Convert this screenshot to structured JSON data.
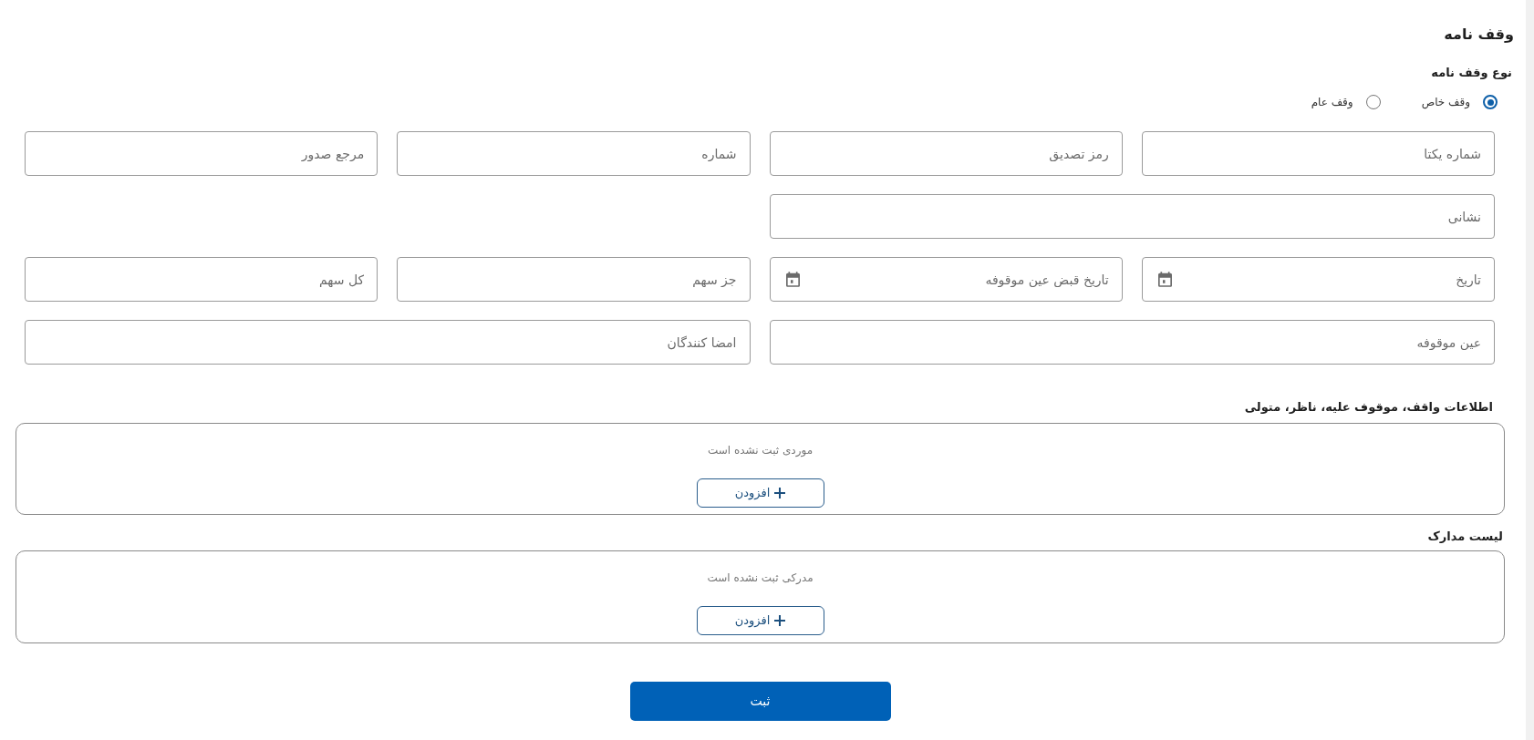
{
  "title": "وقف نامه",
  "waqf_type": {
    "label": "نوع وقف نامه",
    "options": [
      {
        "label": "وقف خاص",
        "selected": true
      },
      {
        "label": "وقف عام",
        "selected": false
      }
    ]
  },
  "field_rows": [
    [
      {
        "kind": "text",
        "placeholder": "شماره یکتا"
      },
      {
        "kind": "text",
        "placeholder": "رمز تصدیق"
      },
      {
        "kind": "text",
        "placeholder": "شماره"
      },
      {
        "kind": "text",
        "placeholder": "مرجع صدور"
      }
    ],
    [
      {
        "kind": "text",
        "placeholder": "نشانی"
      }
    ],
    [
      {
        "kind": "date",
        "placeholder": "تاریخ"
      },
      {
        "kind": "date",
        "placeholder": "تاریخ قبض عین موقوفه"
      },
      {
        "kind": "text",
        "placeholder": "جز سهم"
      },
      {
        "kind": "text",
        "placeholder": "کل سهم"
      }
    ],
    [
      {
        "kind": "text",
        "placeholder": "عین موقوفه"
      },
      {
        "kind": "text",
        "placeholder": "امضا کنندگان"
      }
    ]
  ],
  "sections": [
    {
      "title": "اطلاعات واقف، موقوف علیه، ناظر، متولی",
      "empty_text": "موردی ثبت نشده است",
      "add_button": "افزودن"
    },
    {
      "title": "لیست مدارک",
      "empty_text": "مدرکی ثبت نشده است",
      "add_button": "افزودن"
    }
  ],
  "submit_button": "ثبت"
}
